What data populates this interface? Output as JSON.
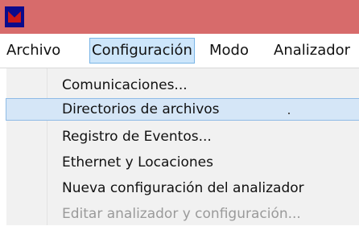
{
  "window": {
    "icon_name": "app-logo-icon",
    "titlebar_color": "#d76b6b"
  },
  "menubar": {
    "items": [
      {
        "label": "Archivo"
      },
      {
        "label": "Configuración"
      },
      {
        "label": "Modo"
      },
      {
        "label": "Analizador"
      }
    ],
    "active": "Configuración"
  },
  "dropdown": {
    "items": [
      {
        "label": "Comunicaciones...",
        "state": "normal"
      },
      {
        "label": "Directorios de archivos",
        "state": "hover"
      },
      {
        "label": "Registro de Eventos...",
        "state": "normal"
      },
      {
        "label": "Ethernet y Locaciones",
        "state": "normal"
      },
      {
        "label": "Nueva configuración del analizador",
        "state": "normal"
      },
      {
        "label": "Editar analizador y configuración...",
        "state": "disabled"
      }
    ]
  }
}
